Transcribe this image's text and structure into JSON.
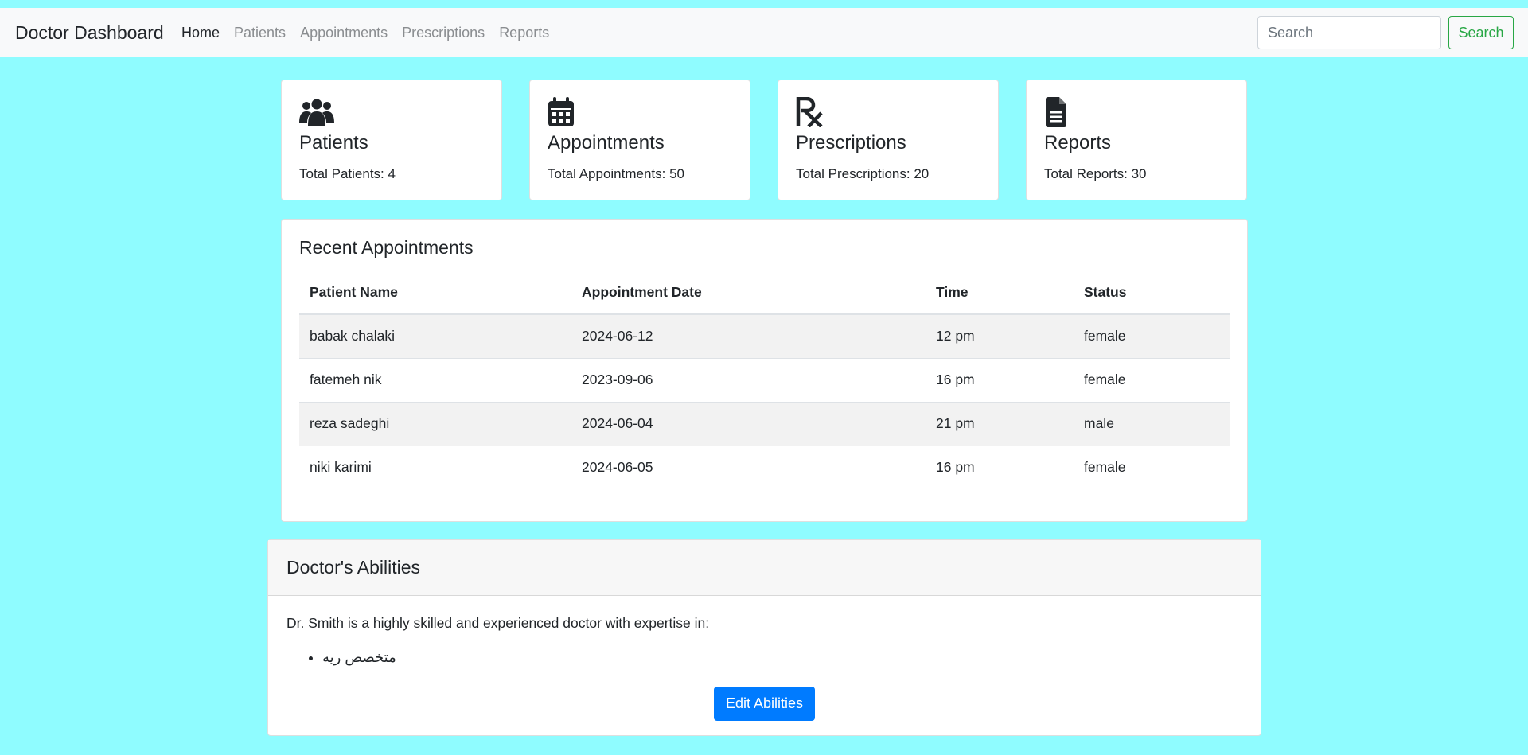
{
  "navbar": {
    "brand": "Doctor Dashboard",
    "links": [
      "Home",
      "Patients",
      "Appointments",
      "Prescriptions",
      "Reports"
    ],
    "active_link": "Home",
    "search_placeholder": "Search",
    "search_button": "Search"
  },
  "stats": [
    {
      "icon": "users-icon",
      "title": "Patients",
      "text": "Total Patients: 4"
    },
    {
      "icon": "calendar-icon",
      "title": "Appointments",
      "text": "Total Appointments: 50"
    },
    {
      "icon": "prescription-icon",
      "title": "Prescriptions",
      "text": "Total Prescriptions: 20"
    },
    {
      "icon": "file-icon",
      "title": "Reports",
      "text": "Total Reports: 30"
    }
  ],
  "appointments": {
    "title": "Recent Appointments",
    "columns": [
      "Patient Name",
      "Appointment Date",
      "Time",
      "Status"
    ],
    "rows": [
      [
        "babak chalaki",
        "2024-06-12",
        "12 pm",
        "female"
      ],
      [
        "fatemeh nik",
        "2023-09-06",
        "16 pm",
        "female"
      ],
      [
        "reza sadeghi",
        "2024-06-04",
        "21 pm",
        "male"
      ],
      [
        "niki karimi",
        "2024-06-05",
        "16 pm",
        "female"
      ]
    ]
  },
  "abilities": {
    "title": "Doctor's Abilities",
    "description": "Dr. Smith is a highly skilled and experienced doctor with expertise in:",
    "items": [
      "متخصص ریه"
    ],
    "edit_button": "Edit Abilities"
  },
  "colors": {
    "background": "#8ffcff",
    "search_button": "#28a745",
    "primary_button": "#007bff"
  }
}
